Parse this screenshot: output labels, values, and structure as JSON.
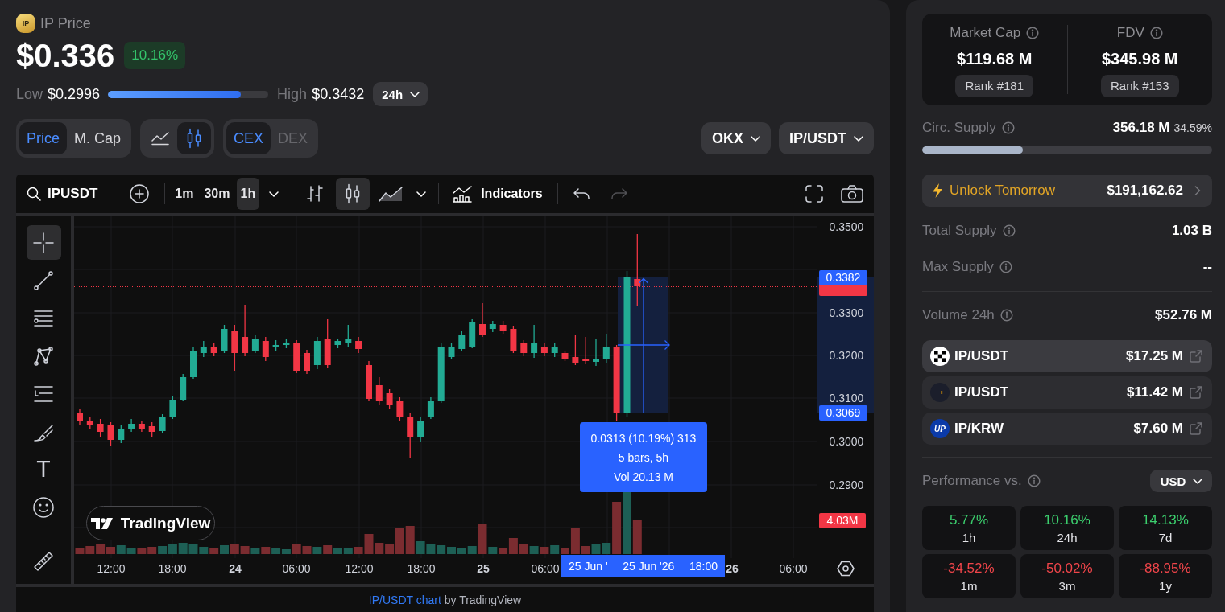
{
  "header": {
    "logo": "IP",
    "title": "IP Price",
    "price": "$0.336",
    "change": "10.16%",
    "low_label": "Low",
    "low": "$0.2996",
    "range": {
      "level": 0.83
    },
    "high_label": "High",
    "high": "$0.3432",
    "period": "24h"
  },
  "toggles": [
    {
      "kind": "text",
      "options": [
        {
          "label": "Price",
          "selected": true,
          "disabled": false
        },
        {
          "label": "M. Cap",
          "selected": false,
          "disabled": false
        }
      ]
    },
    {
      "kind": "icon",
      "options": [
        {
          "selected": false,
          "disabled": false
        },
        {
          "selected": true,
          "disabled": false
        }
      ]
    },
    {
      "kind": "text",
      "options": [
        {
          "label": "CEX",
          "selected": true,
          "disabled": false
        },
        {
          "label": "DEX",
          "selected": false,
          "disabled": true
        }
      ]
    }
  ],
  "selectors": [
    {
      "label": "OKX"
    },
    {
      "label": "IP/USDT"
    }
  ],
  "chart": {
    "toolbar": {
      "symbol": "IPUSDT",
      "intervals": [
        {
          "label": "1m",
          "selected": false
        },
        {
          "label": "30m",
          "selected": false
        },
        {
          "label": "1h",
          "selected": true
        }
      ],
      "chart_types": [
        {
          "selected": false
        },
        {
          "selected": true
        },
        {
          "selected": false
        }
      ],
      "indicators": "Indicators",
      "history": [
        {
          "disabled": false
        },
        {
          "disabled": true
        }
      ]
    },
    "drawing_tools": [
      {
        "selected": true
      },
      {
        "selected": false
      },
      {
        "selected": false
      },
      {
        "selected": false
      },
      {
        "selected": false
      },
      {
        "selected": false
      },
      {
        "selected": false,
        "glyph": "T"
      },
      {
        "selected": false
      },
      {
        "selected": false
      }
    ],
    "price_ticks": [
      "0.3500",
      "0.3300",
      "0.3200",
      "0.3100",
      "0.3000",
      "0.2900"
    ],
    "time_labels": [
      {
        "text": "12:00",
        "kind": "time"
      },
      {
        "text": "18:00",
        "kind": "time"
      },
      {
        "text": "24",
        "kind": "day"
      },
      {
        "text": "06:00",
        "kind": "time"
      },
      {
        "text": "12:00",
        "kind": "time"
      },
      {
        "text": "18:00",
        "kind": "time"
      },
      {
        "text": "25",
        "kind": "day"
      },
      {
        "text": "06:00",
        "kind": "time"
      },
      {
        "text": "26",
        "kind": "day"
      },
      {
        "text": "06:00",
        "kind": "time"
      }
    ],
    "price_tags": [
      {
        "text": "0.3382",
        "kind": "measure"
      },
      {
        "text": "0.3069",
        "kind": "measure"
      },
      {
        "text": "4.03M",
        "kind": "volume"
      }
    ],
    "measure": {
      "lines": [
        "0.0313 (10.19%) 313",
        "5 bars, 5h",
        "Vol 20.13 M"
      ],
      "dates": [
        "25 Jun '",
        "25 Jun '26",
        "18:00"
      ]
    },
    "logo": "TradingView",
    "attribution": {
      "link": "IP/USDT chart",
      "text": "by TradingView"
    }
  },
  "market": [
    {
      "label": "Market Cap",
      "value": "$119.68 M",
      "rank": "Rank #181"
    },
    {
      "label": "FDV",
      "value": "$345.98 M",
      "rank": "Rank #153"
    }
  ],
  "circ_supply": {
    "label": "Circ. Supply",
    "value": "356.18 M",
    "percent": "34.59%",
    "level": 0.3459
  },
  "unlock": {
    "label": "Unlock Tomorrow",
    "value": "$191,162.62"
  },
  "supply": [
    {
      "label": "Total Supply",
      "value": "1.03 B"
    },
    {
      "label": "Max Supply",
      "value": "--"
    }
  ],
  "volume": {
    "label": "Volume 24h",
    "value": "$52.76 M"
  },
  "markets": [
    {
      "kind": "okx",
      "pair": "IP/USDT",
      "volume": "$17.25 M",
      "selected": true
    },
    {
      "kind": "bybit",
      "pair": "IP/USDT",
      "volume": "$11.42 M",
      "selected": false
    },
    {
      "kind": "upbit",
      "logo": "UP",
      "pair": "IP/KRW",
      "volume": "$7.60 M",
      "selected": false
    }
  ],
  "performance": {
    "label": "Performance vs.",
    "currency": "USD",
    "cells": [
      {
        "value": "5.77%",
        "period": "1h",
        "kind": "gain"
      },
      {
        "value": "10.16%",
        "period": "24h",
        "kind": "gain"
      },
      {
        "value": "14.13%",
        "period": "7d",
        "kind": "gain"
      },
      {
        "value": "-34.52%",
        "period": "1m",
        "kind": "loss"
      },
      {
        "value": "-50.02%",
        "period": "3m",
        "kind": "loss"
      },
      {
        "value": "-88.95%",
        "period": "1y",
        "kind": "loss"
      }
    ]
  }
}
